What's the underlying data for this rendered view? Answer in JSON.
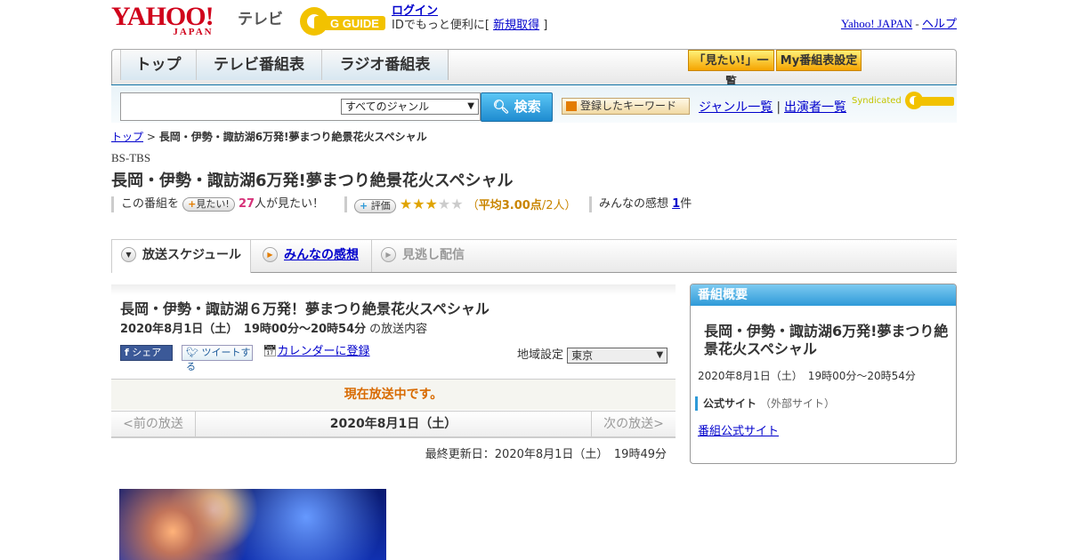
{
  "header": {
    "logo_main": "YAHOO!",
    "logo_sub": "JAPAN",
    "service_label": "テレビ",
    "gguide_logo": "G GUIDE",
    "login_link": "ログイン",
    "login_prefix": "IDでもっと便利に[ ",
    "signup_link": "新規取得",
    "login_suffix": " ]",
    "yahoo_japan_link": "Yahoo! JAPAN",
    "separator": " - ",
    "help_link": "ヘルプ"
  },
  "nav": {
    "tabs": [
      {
        "label": "トップ"
      },
      {
        "label": "テレビ番組表"
      },
      {
        "label": "ラジオ番組表"
      }
    ],
    "want_list_button": "「見たい!」一覧",
    "my_schedule_button": "My番組表設定"
  },
  "search": {
    "input_value": "",
    "genre_selected": "すべてのジャンル",
    "search_button": "検索",
    "keyword_button": "登録したキーワード",
    "genre_list_link": "ジャンル一覧",
    "separator": "|",
    "cast_list_link": "出演者一覧",
    "syndicated_label": "Syndicated"
  },
  "breadcrumb": {
    "top_link": "トップ",
    "arrow": " > ",
    "current": "長岡・伊勢・諏訪湖6万発!夢まつり絶景花火スペシャル"
  },
  "program": {
    "channel": "BS-TBS",
    "title": "長岡・伊勢・諏訪湖6万発!夢まつり絶景花火スペシャル",
    "want_prefix": "この番組を",
    "want_pill": "見たい!",
    "want_count": "27",
    "want_suffix": "人が見たい！",
    "rating_pill": "評価",
    "rating_stars": 3,
    "rating_max": 5,
    "rating_open": "（",
    "rating_avg": "平均3.00点",
    "rating_people": "/2人）",
    "impressions_label": "みんなの感想 ",
    "impressions_count": "1",
    "impressions_suffix": "件"
  },
  "tabs": {
    "schedule": "放送スケジュール",
    "impressions": "みんなの感想",
    "catchup": "見逃し配信"
  },
  "broadcast": {
    "title": "長岡・伊勢・諏訪湖６万発！夢まつり絶景花火スペシャル",
    "datetime": "2020年8月1日（土）　19時00分～20時54分",
    "datetime_suffix": "の放送内容",
    "fb_share": "シェア",
    "tweet": "ツイートする",
    "calendar_link": "カレンダーに登録",
    "region_label": "地域設定",
    "region_value": "東京",
    "on_air_notice": "現在放送中です。",
    "prev_link": "<前の放送",
    "current_date": "2020年8月1日（土）",
    "next_link": "次の放送>",
    "last_updated": "最終更新日：2020年8月1日（土）　19時49分"
  },
  "sidebar": {
    "heading": "番組概要",
    "title": "長岡・伊勢・諏訪湖6万発!夢まつり絶景花火スペシャル",
    "datetime": "2020年8月1日（土）　19時00分～20時54分",
    "official_label": "公式サイト",
    "external_label": "（外部サイト）",
    "official_link": "番組公式サイト"
  },
  "colors": {
    "accent_blue": "#2aa3dc",
    "yahoo_red": "#d0021b",
    "on_air_orange": "#d86a00",
    "rating_gold": "#e0a400"
  }
}
